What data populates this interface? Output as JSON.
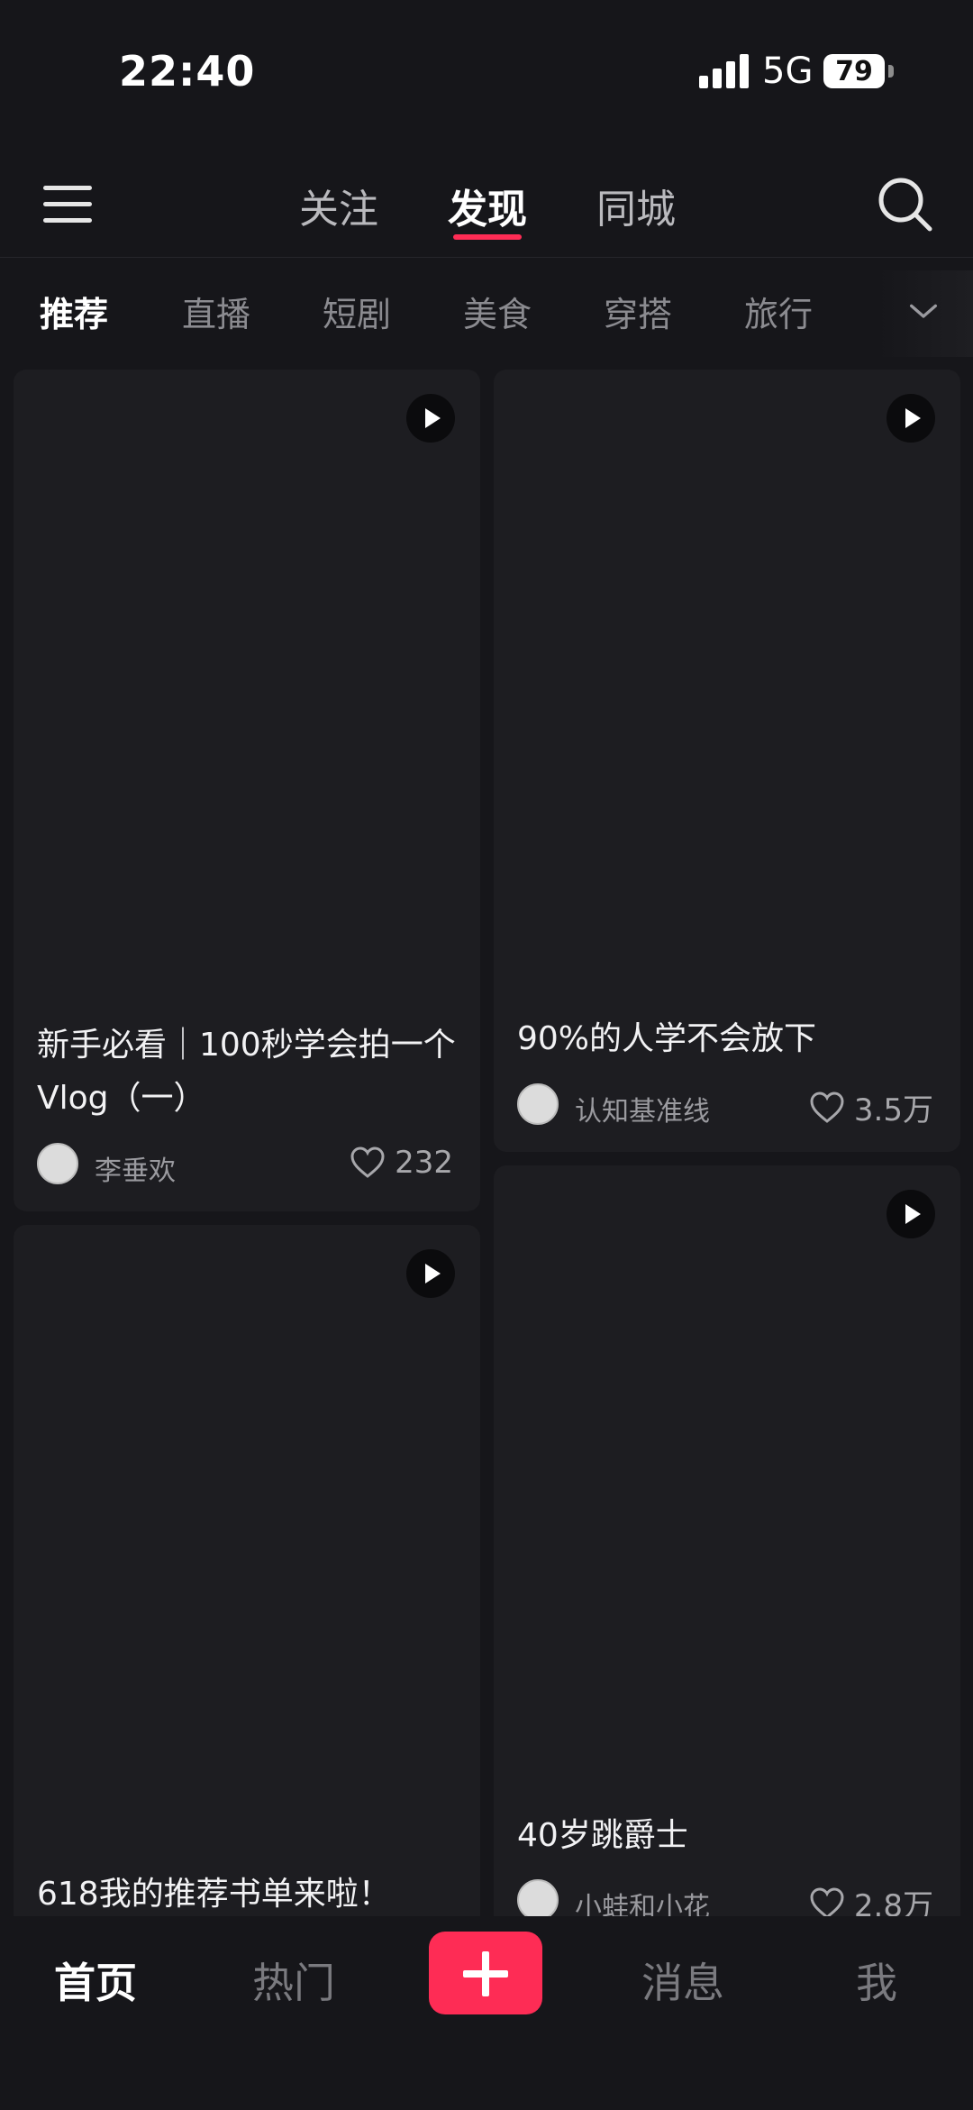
{
  "status_bar": {
    "time": "22:40",
    "network": "5G",
    "battery": "79"
  },
  "top_nav": {
    "tabs": [
      "关注",
      "发现",
      "同城"
    ],
    "active_tab": "发现"
  },
  "categories": {
    "items": [
      "推荐",
      "直播",
      "短剧",
      "美食",
      "穿搭",
      "旅行"
    ],
    "active": "推荐"
  },
  "feed": [
    {
      "title": "新手必看｜100秒学会拍一个Vlog（一）",
      "author": "李垂欢",
      "likes": "232"
    },
    {
      "title": "90%的人学不会放下",
      "author": "认知基准线",
      "likes": "3.5万"
    },
    {
      "title": "618我的推荐书单来啦！",
      "author": "",
      "likes": ""
    },
    {
      "title": "40岁跳爵士",
      "author": "小蛙和小花",
      "likes": "2.8万"
    }
  ],
  "bottom_nav": {
    "items": [
      "首页",
      "热门",
      "消息",
      "我"
    ],
    "active": "首页"
  },
  "colors": {
    "accent": "#fe2c55",
    "background": "#16161a",
    "card": "#1d1d21"
  }
}
